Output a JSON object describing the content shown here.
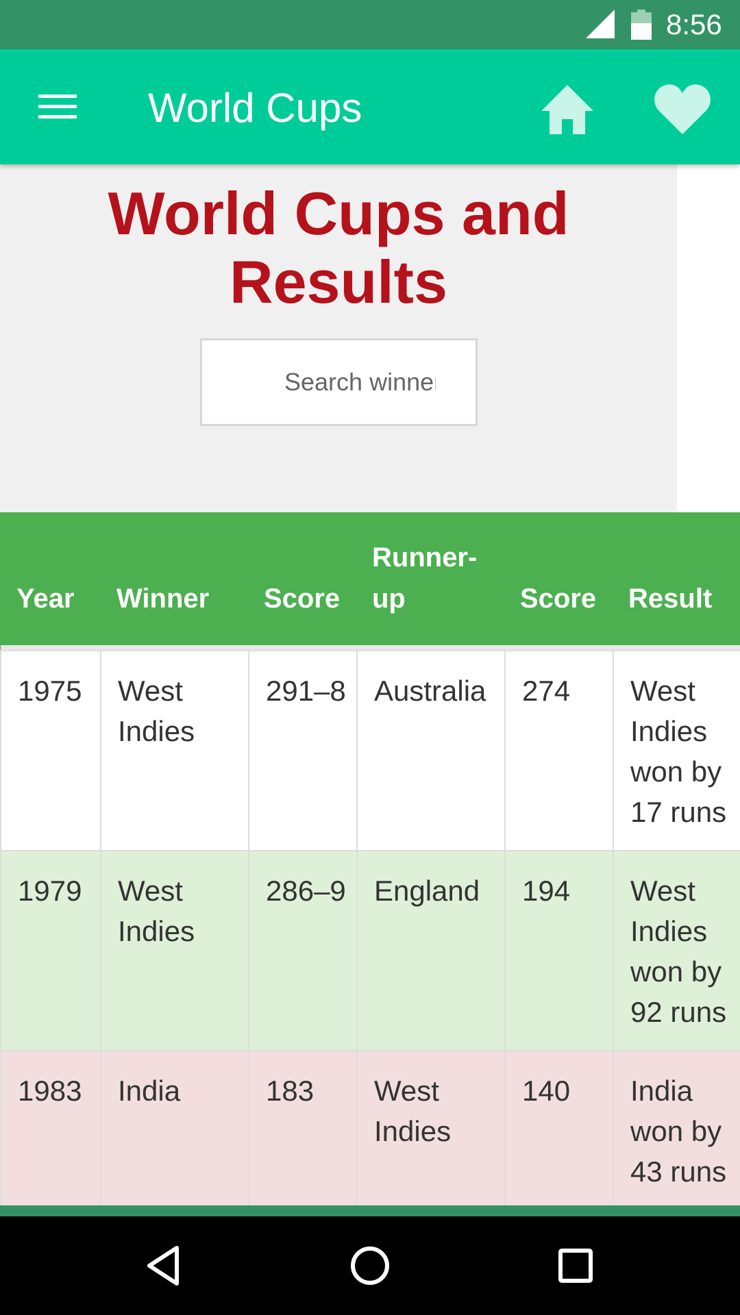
{
  "status_bar": {
    "time": "8:56",
    "signal_icon": "signal-icon",
    "battery_icon": "battery-icon"
  },
  "toolbar": {
    "title": "World Cups",
    "menu_icon": "hamburger-menu-icon",
    "home_icon": "home-icon",
    "favorite_icon": "heart-icon",
    "background": "#00cc99",
    "icon_color": "#c9f5e8"
  },
  "header": {
    "title": "World Cups and Results",
    "title_color": "#b5121b",
    "search": {
      "placeholder": "Search winner",
      "value": ""
    }
  },
  "table": {
    "columns": [
      "Year",
      "Winner",
      "Score",
      "Runner-up",
      "Score",
      "Result"
    ],
    "header_color": "#4caf50",
    "rows": [
      {
        "year": "1975",
        "winner": "West Indies",
        "winner_score": "291–8",
        "runner_up": "Australia",
        "runner_score": "274",
        "result": "West Indies won by 17 runs",
        "color": "#ffffff"
      },
      {
        "year": "1979",
        "winner": "West Indies",
        "winner_score": "286–9",
        "runner_up": "England",
        "runner_score": "194",
        "result": "West Indies won by 92 runs",
        "color": "#dff0d8"
      },
      {
        "year": "1983",
        "winner": "India",
        "winner_score": "183",
        "runner_up": "West Indies",
        "runner_score": "140",
        "result": "India won by 43 runs",
        "color": "#f2dede"
      }
    ]
  },
  "nav_bar": {
    "back_icon": "back-triangle-icon",
    "home_icon": "home-circle-icon",
    "recents_icon": "recents-square-icon"
  }
}
